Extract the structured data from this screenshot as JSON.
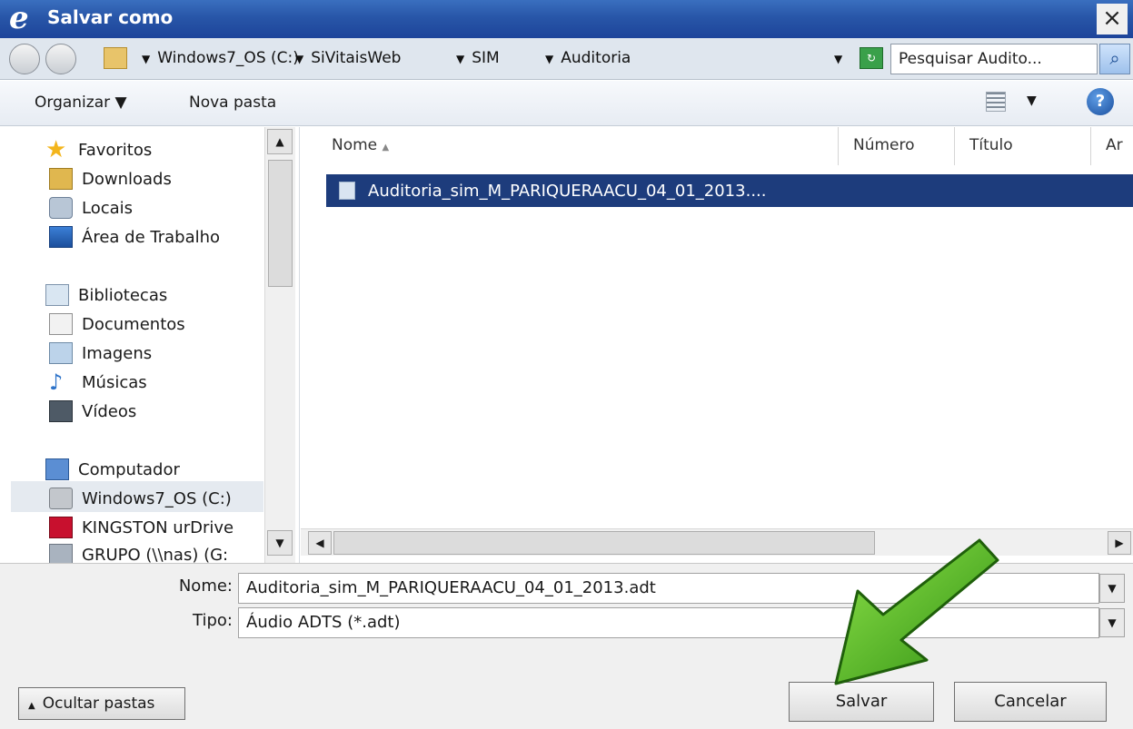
{
  "window": {
    "title": "Salvar como",
    "close_glyph": "×"
  },
  "address": {
    "breadcrumbs": [
      "Windows7_OS (C:)",
      "SiVitaisWeb",
      "SIM",
      "Auditoria"
    ],
    "search_placeholder": "Pesquisar Audito...",
    "search_icon": "search-icon"
  },
  "toolbar": {
    "organize_label": "Organizar ▼",
    "new_folder_label": "Nova pasta",
    "help_glyph": "?"
  },
  "navigation": {
    "favorites": {
      "label": "Favoritos",
      "items": [
        "Downloads",
        "Locais",
        "Área de Trabalho"
      ]
    },
    "libraries": {
      "label": "Bibliotecas",
      "items": [
        "Documentos",
        "Imagens",
        "Músicas",
        "Vídeos"
      ]
    },
    "computer": {
      "label": "Computador",
      "items": [
        "Windows7_OS (C:)",
        "KINGSTON urDrive",
        "GRUPO (\\\\nas) (G:"
      ]
    }
  },
  "filelist": {
    "columns": [
      "Nome",
      "Número",
      "Título",
      "Ar"
    ],
    "files": [
      {
        "name": "Auditoria_sim_M_PARIQUERAACU_04_01_2013....",
        "selected": true
      }
    ]
  },
  "form": {
    "name_label": "Nome:",
    "name_value": "Auditoria_sim_M_PARIQUERAACU_04_01_2013.adt",
    "type_label": "Tipo:",
    "type_value": "Áudio ADTS (*.adt)"
  },
  "buttons": {
    "hide_folders": "Ocultar pastas",
    "save": "Salvar",
    "cancel": "Cancelar"
  },
  "colors": {
    "title_bar": "#2856a8",
    "selection": "#1d3c7c",
    "arrow": "#4cbf1f"
  }
}
